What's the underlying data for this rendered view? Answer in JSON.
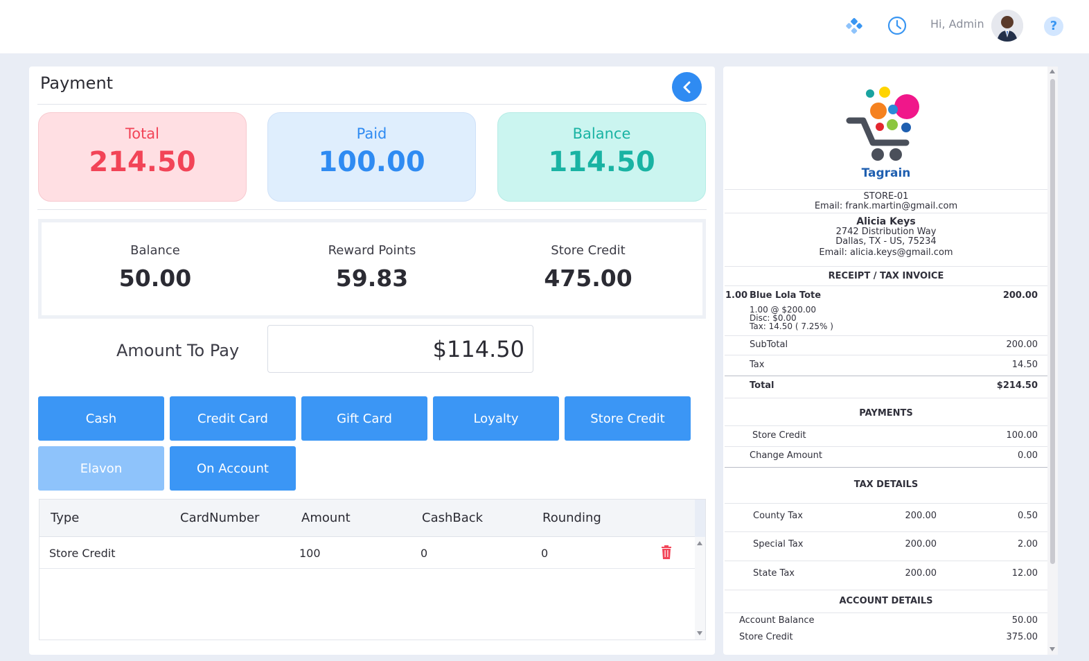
{
  "header": {
    "greeting": "Hi, Admin",
    "icons": [
      "apps-icon",
      "clock-icon",
      "avatar",
      "help-icon"
    ],
    "help_glyph": "?"
  },
  "payment": {
    "title": "Payment",
    "summary": {
      "total_label": "Total",
      "total_value": "214.50",
      "paid_label": "Paid",
      "paid_value": "100.00",
      "balance_label": "Balance",
      "balance_value": "114.50"
    },
    "account": {
      "balance_label": "Balance",
      "balance_value": "50.00",
      "reward_label": "Reward Points",
      "reward_value": "59.83",
      "store_credit_label": "Store Credit",
      "store_credit_value": "475.00"
    },
    "amount_to_pay_label": "Amount To Pay",
    "amount_to_pay_value": "$114.50",
    "buttons": [
      "Cash",
      "Credit Card",
      "Gift Card",
      "Loyalty",
      "Store Credit",
      "Elavon",
      "On Account"
    ],
    "table": {
      "columns": [
        "Type",
        "CardNumber",
        "Amount",
        "CashBack",
        "Rounding"
      ],
      "rows": [
        {
          "type": "Store Credit",
          "card": "",
          "amount": "100",
          "cashback": "0",
          "rounding": "0"
        }
      ]
    }
  },
  "receipt": {
    "brand": "Tagrain",
    "store": "STORE-01",
    "store_email": "Email: frank.martin@gmail.com",
    "customer_name": "Alicia Keys",
    "customer_addr1": "2742 Distribution Way",
    "customer_addr2": "Dallas, TX - US, 75234",
    "customer_email": "Email: alicia.keys@gmail.com",
    "heading": "RECEIPT / TAX INVOICE",
    "item": {
      "qty": "1.00",
      "name": "Blue Lola Tote",
      "amount": "200.00",
      "detail1": "1.00 @ $200.00",
      "detail2": "Disc: $0.00",
      "detail3": "Tax: 14.50 ( 7.25% )"
    },
    "subtotal_label": "SubTotal",
    "subtotal": "200.00",
    "tax_label": "Tax",
    "tax": "14.50",
    "total_label": "Total",
    "total": "$214.50",
    "payments_heading": "PAYMENTS",
    "payments": [
      {
        "label": "Store Credit",
        "value": "100.00"
      },
      {
        "label": "Change Amount",
        "value": "0.00"
      }
    ],
    "tax_heading": "TAX DETAILS",
    "taxes": [
      {
        "label": "County Tax",
        "base": "200.00",
        "value": "0.50"
      },
      {
        "label": "Special Tax",
        "base": "200.00",
        "value": "2.00"
      },
      {
        "label": "State Tax",
        "base": "200.00",
        "value": "12.00"
      }
    ],
    "account_heading": "ACCOUNT DETAILS",
    "account": [
      {
        "label": "Account Balance",
        "value": "50.00"
      },
      {
        "label": "Store Credit",
        "value": "375.00"
      }
    ]
  },
  "colors": {
    "primary": "#3b96f5",
    "total": "#f24457",
    "paid": "#2f8bf2",
    "balance": "#19b3a3",
    "danger": "#f24457"
  }
}
